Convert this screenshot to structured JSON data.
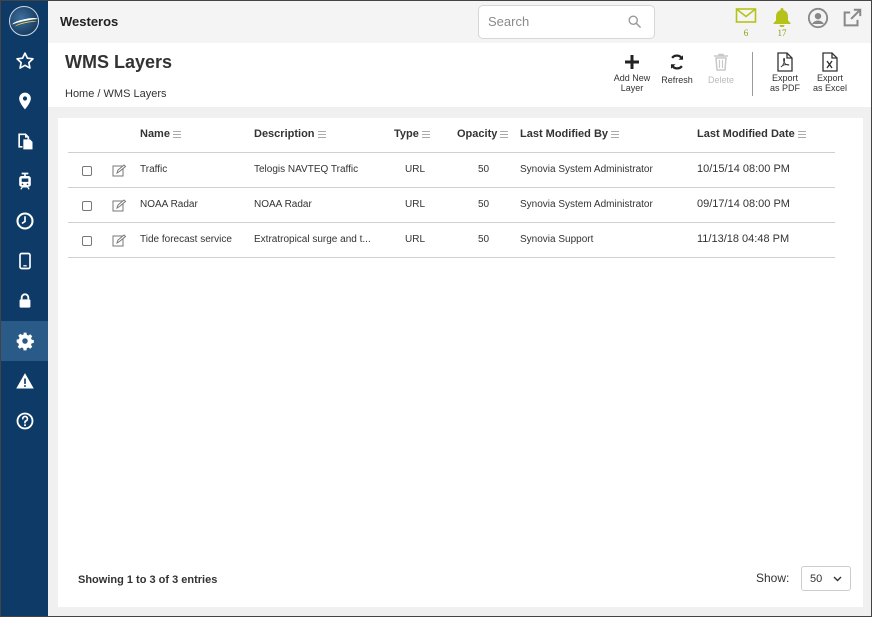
{
  "app": {
    "name": "Westeros"
  },
  "sidebar": {
    "items": [
      {
        "icon": "star-icon",
        "active": false
      },
      {
        "icon": "map-pin-icon",
        "active": false
      },
      {
        "icon": "documents-icon",
        "active": false
      },
      {
        "icon": "train-icon",
        "active": false
      },
      {
        "icon": "clock-icon",
        "active": false
      },
      {
        "icon": "tablet-icon",
        "active": false
      },
      {
        "icon": "lock-icon",
        "active": false
      },
      {
        "icon": "gear-icon",
        "active": true
      },
      {
        "icon": "warning-icon",
        "active": false
      },
      {
        "icon": "help-icon",
        "active": false
      }
    ]
  },
  "header": {
    "search_placeholder": "Search",
    "messages_count": "6",
    "notifications_count": "17"
  },
  "page": {
    "title": "WMS Layers",
    "breadcrumb": {
      "home": "Home",
      "separator": "/",
      "current": "WMS Layers"
    }
  },
  "toolbar": {
    "add_line1": "Add New",
    "add_line2": "Layer",
    "refresh": "Refresh",
    "delete": "Delete",
    "pdf_line1": "Export",
    "pdf_line2": "as PDF",
    "excel_line1": "Export",
    "excel_line2": "as Excel"
  },
  "table": {
    "columns": {
      "name": "Name",
      "description": "Description",
      "type": "Type",
      "opacity": "Opacity",
      "modified_by": "Last Modified By",
      "modified_date": "Last Modified Date"
    },
    "rows": [
      {
        "name": "Traffic",
        "description": "Telogis NAVTEQ Traffic",
        "type": "URL",
        "opacity": "50",
        "modified_by": "Synovia System Administrator",
        "modified_date": "10/15/14 08:00 PM"
      },
      {
        "name": "NOAA Radar",
        "description": "NOAA Radar",
        "type": "URL",
        "opacity": "50",
        "modified_by": "Synovia System Administrator",
        "modified_date": "09/17/14 08:00 PM"
      },
      {
        "name": "Tide forecast service",
        "description": "Extratropical surge and t...",
        "type": "URL",
        "opacity": "50",
        "modified_by": "Synovia Support",
        "modified_date": "11/13/18 04:48 PM"
      }
    ]
  },
  "footer": {
    "info": "Showing 1 to 3 of 3 entries",
    "show_label": "Show:",
    "page_size": "50"
  },
  "colors": {
    "sidebar": "#0d3a66",
    "sidebar_active": "#2a5a88",
    "accent": "#b5c21a",
    "text": "#333333"
  }
}
